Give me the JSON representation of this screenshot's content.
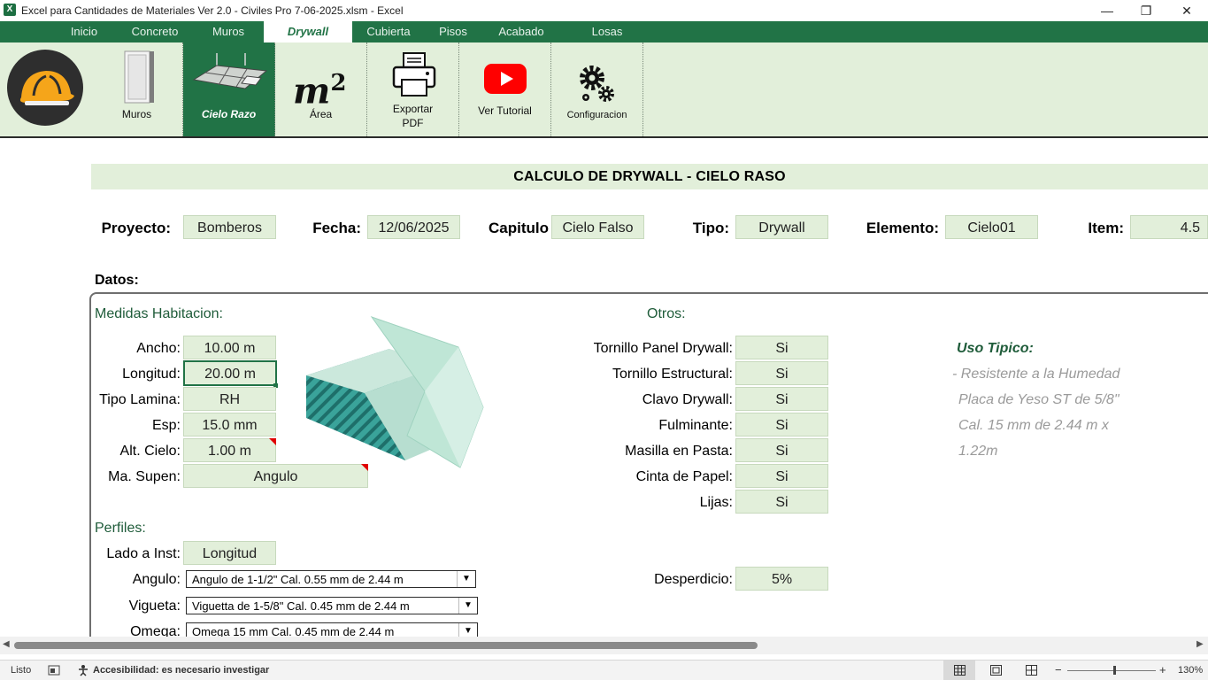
{
  "window": {
    "title": "Excel para Cantidades de Materiales Ver 2.0 - Civiles Pro 7-06-2025.xlsm  -  Excel",
    "app_icon": "X",
    "min": "—",
    "max": "❐",
    "close": "✕"
  },
  "menu": [
    "Inicio",
    "Concreto",
    "Muros",
    "Drywall",
    "Cubierta",
    "Pisos",
    "Acabado",
    "Losas"
  ],
  "ribbon": {
    "muros": "Muros",
    "cielo": "Cielo Razo",
    "area_symbol": "m",
    "area_exp": "2",
    "area": "Área",
    "exportar_1": "Exportar",
    "exportar_2": "PDF",
    "tutorial": "Ver Tutorial",
    "config": "Configuracion"
  },
  "banner": "CALCULO DE DRYWALL - CIELO RASO",
  "header": {
    "proyecto_label": "Proyecto:",
    "proyecto": "Bomberos",
    "fecha_label": "Fecha:",
    "fecha": "12/06/2025",
    "capitulo_label": "Capitulo",
    "capitulo": "Cielo Falso",
    "tipo_label": "Tipo:",
    "tipo": "Drywall",
    "elemento_label": "Elemento:",
    "elemento": "Cielo01",
    "item_label": "Item:",
    "item": "4.5"
  },
  "datos_label": "Datos:",
  "medidas": {
    "title": "Medidas Habitacion:",
    "ancho_label": "Ancho:",
    "ancho": "10.00 m",
    "longitud_label": "Longitud:",
    "longitud": "20.00 m",
    "lamina_label": "Tipo Lamina:",
    "lamina": "RH",
    "esp_label": "Esp:",
    "esp": "15.0 mm",
    "alt_label": "Alt. Cielo:",
    "alt": "1.00 m",
    "masupen_label": "Ma. Supen:",
    "masupen": "Angulo"
  },
  "perfiles": {
    "title": "Perfiles:",
    "lado_label": "Lado a Inst:",
    "lado": "Longitud",
    "angulo_label": "Angulo:",
    "angulo": "Angulo de 1-1/2\" Cal. 0.55 mm de 2.44 m",
    "vigueta_label": "Vigueta:",
    "vigueta": "Viguetta de 1-5/8\" Cal. 0.45 mm de 2.44 m",
    "omega_label": "Omega:",
    "omega": "Omega 15 mm Cal. 0.45 mm de 2.44 m"
  },
  "otros": {
    "title": "Otros:",
    "items": [
      {
        "label": "Tornillo Panel Drywall:",
        "value": "Si"
      },
      {
        "label": "Tornillo Estructural:",
        "value": "Si"
      },
      {
        "label": "Clavo Drywall:",
        "value": "Si"
      },
      {
        "label": "Fulminante:",
        "value": "Si"
      },
      {
        "label": "Masilla en Pasta:",
        "value": "Si"
      },
      {
        "label": "Cinta de Papel:",
        "value": "Si"
      },
      {
        "label": "Lijas:",
        "value": "Si"
      }
    ],
    "desperdicio_label": "Desperdicio:",
    "desperdicio": "5%"
  },
  "uso": {
    "title": "Uso Tipico:",
    "lines": [
      "- Resistente a la Humedad",
      "Placa de Yeso ST de 5/8\"",
      "Cal. 15 mm de 2.44 m x",
      "1.22m"
    ]
  },
  "status": {
    "listo": "Listo",
    "accesibilidad": "Accesibilidad: es necesario investigar",
    "zoom": "130%",
    "minus": "−",
    "plus": "+"
  }
}
